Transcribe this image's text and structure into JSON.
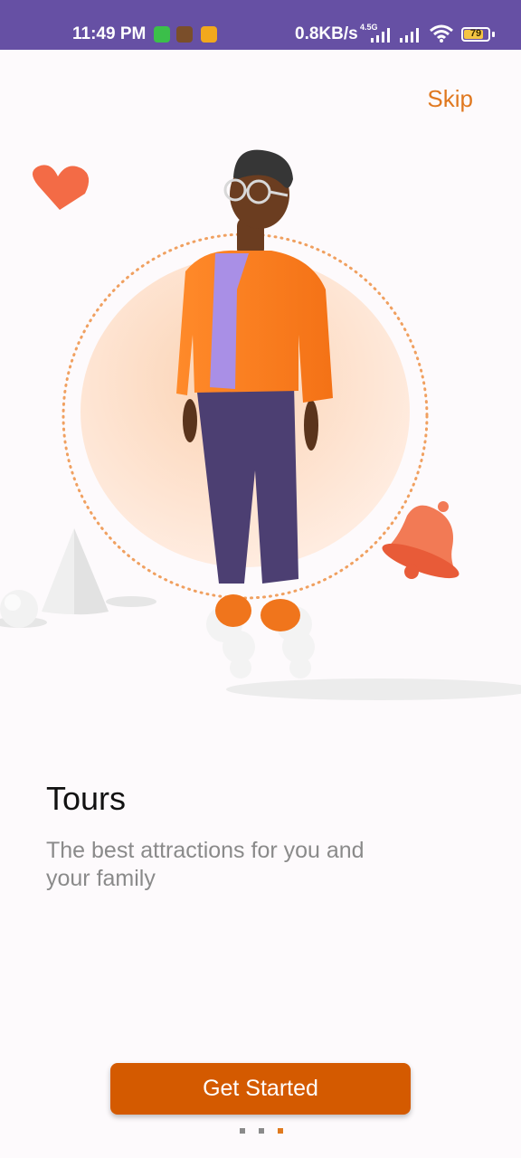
{
  "status_bar": {
    "time": "11:49 PM",
    "network_speed": "0.8KB/s",
    "network_type": "4.5G",
    "battery_level": "79",
    "battery_fraction": 0.79,
    "icons": [
      "app-notification-icon",
      "game-notification-icon",
      "chat-notification-icon",
      "signal-icon",
      "signal-icon",
      "wifi-icon",
      "battery-icon"
    ],
    "background_color": "#6650a4"
  },
  "onboarding": {
    "skip_label": "Skip",
    "title": "Tours",
    "subtitle": "The best attractions for you and your family",
    "button_label": "Get Started",
    "page_count": 3,
    "current_page": 3,
    "accent_color": "#d45a00",
    "illustration_icons": [
      "heart-icon",
      "bell-icon",
      "cone-shape",
      "sphere-shape",
      "person-figure"
    ]
  }
}
